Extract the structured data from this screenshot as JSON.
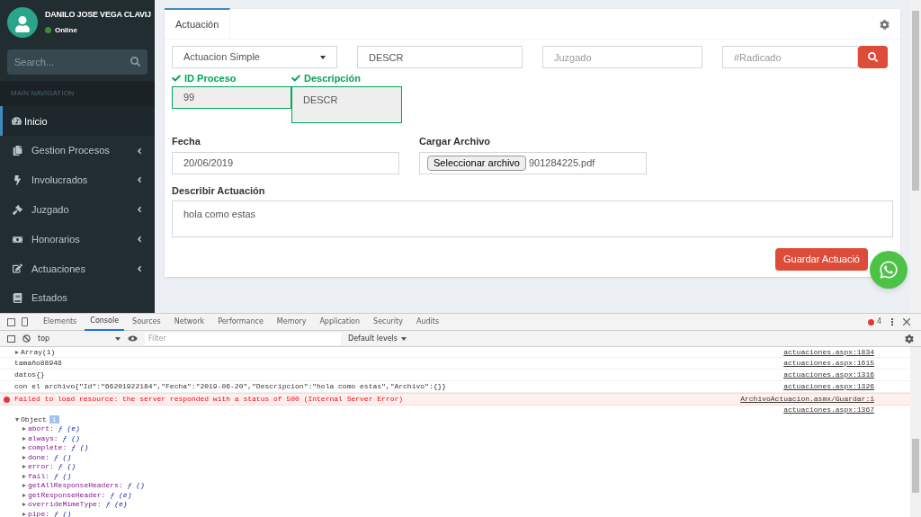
{
  "sidebar": {
    "user": {
      "name": "DANILO JOSE VEGA CLAVIJ",
      "status": "Online",
      "online": true
    },
    "search": {
      "placeholder": "Search..."
    },
    "nav_header": "MAIN NAVIGATION",
    "items": [
      {
        "label": "Inicio",
        "selected": true,
        "has_submenu": false
      },
      {
        "label": "Gestion Procesos",
        "selected": false,
        "has_submenu": true
      },
      {
        "label": "Involucrados",
        "selected": false,
        "has_submenu": true
      },
      {
        "label": "Juzgado",
        "selected": false,
        "has_submenu": true
      },
      {
        "label": "Honorarios",
        "selected": false,
        "has_submenu": true
      },
      {
        "label": "Actuaciones",
        "selected": false,
        "has_submenu": true
      },
      {
        "label": "Estados",
        "selected": false,
        "has_submenu": false
      }
    ]
  },
  "card": {
    "tabs": [
      {
        "label": "Actuación",
        "selected": true
      }
    ],
    "type_select": {
      "value": "Actuacion Simple"
    },
    "descr_field": {
      "value": "DESCR"
    },
    "juzgado_field": {
      "placeholder": "Juzgado"
    },
    "radicado_field": {
      "placeholder": "#Radicado"
    },
    "id_proceso": {
      "label": "ID Proceso",
      "value": "99",
      "valid": true
    },
    "descripcion": {
      "label": "Descripción",
      "value": "DESCR",
      "valid": true
    },
    "fecha": {
      "label": "Fecha",
      "value": "20/06/2019"
    },
    "archivo": {
      "label": "Cargar Archivo",
      "button": "Seleccionar archivo",
      "file": "901284225.pdf"
    },
    "describir": {
      "label": "Describir Actuación",
      "value": "hola como estas"
    },
    "save_button": "Guardar Actuació"
  },
  "devtools": {
    "tabs": [
      {
        "label": "Elements",
        "selected": false
      },
      {
        "label": "Console",
        "selected": true
      },
      {
        "label": "Sources",
        "selected": false
      },
      {
        "label": "Network",
        "selected": false
      },
      {
        "label": "Performance",
        "selected": false
      },
      {
        "label": "Memory",
        "selected": false
      },
      {
        "label": "Application",
        "selected": false
      },
      {
        "label": "Security",
        "selected": false
      },
      {
        "label": "Audits",
        "selected": false
      }
    ],
    "error_count": "4",
    "context": "top",
    "filter": {
      "placeholder": "Filter"
    },
    "levels": "Default levels",
    "messages": [
      {
        "kind": "collapsed",
        "text": "Array(1)",
        "source": "actuaciones.aspx:1834"
      },
      {
        "kind": "log",
        "text": "tamaño88946",
        "source": "actuaciones.aspx:1615"
      },
      {
        "kind": "log",
        "text": "datos{}",
        "source": "actuaciones.aspx:1316"
      },
      {
        "kind": "log",
        "text": "con el archivo{\"Id\":\"66201922184\",\"Fecha\":\"2019-06-20\",\"Descripcion\":\"hola como estas\",\"Archivo\":{}}",
        "source": "actuaciones.aspx:1326"
      },
      {
        "kind": "error",
        "text": "Failed to load resource: the server responded with a status of 500 (Internal Server Error)",
        "source": "ArchivoActuacion.asmx/Guardar:1"
      },
      {
        "kind": "object",
        "text": "Object",
        "source": "actuaciones.aspx:1367",
        "expanded": true,
        "badge": "i",
        "props": [
          {
            "name": "abort:",
            "value": "ƒ (e)"
          },
          {
            "name": "always:",
            "value": "ƒ ()"
          },
          {
            "name": "complete:",
            "value": "ƒ ()"
          },
          {
            "name": "done:",
            "value": "ƒ ()"
          },
          {
            "name": "error:",
            "value": "ƒ ()"
          },
          {
            "name": "fail:",
            "value": "ƒ ()"
          },
          {
            "name": "getAllResponseHeaders:",
            "value": "ƒ ()"
          },
          {
            "name": "getResponseHeader:",
            "value": "ƒ (e)"
          },
          {
            "name": "overrideMimeType:",
            "value": "ƒ (e)"
          },
          {
            "name": "pipe:",
            "value": "ƒ ()"
          }
        ]
      }
    ]
  }
}
